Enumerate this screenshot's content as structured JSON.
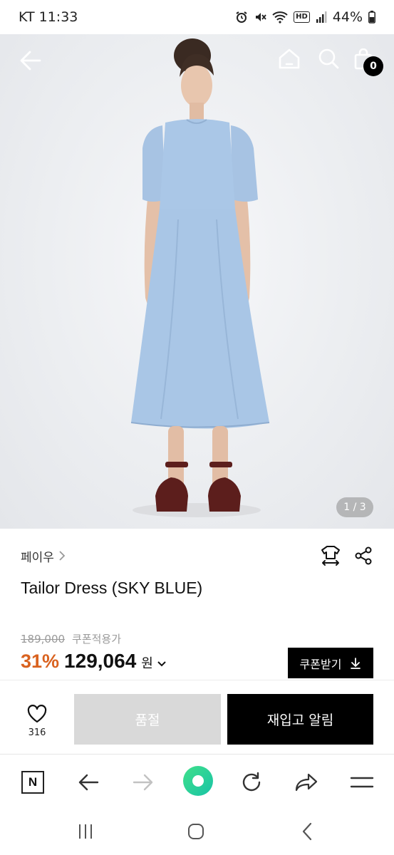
{
  "status_bar": {
    "carrier_time": "KT 11:33",
    "hd_label": "HD",
    "battery": "44%"
  },
  "header": {
    "cart_count": "0"
  },
  "gallery": {
    "page_indicator": "1 / 3"
  },
  "product": {
    "brand": "페이우",
    "title": "Tailor Dress (SKY BLUE)",
    "original_price": "189,000",
    "coupon_applied_label": "쿠폰적용가",
    "discount": "31%",
    "price": "129,064",
    "currency": "원",
    "coupon_button_label": "쿠폰받기"
  },
  "action_bar": {
    "wish_count": "316",
    "soldout_label": "품절",
    "restock_label": "재입고 알림"
  },
  "browser_toolbar": {
    "naver_label": "N"
  },
  "colors": {
    "discount": "#d9621f",
    "dress": "#a9c6e6",
    "soldout": "#d9d9d9",
    "primary": "#000000"
  }
}
